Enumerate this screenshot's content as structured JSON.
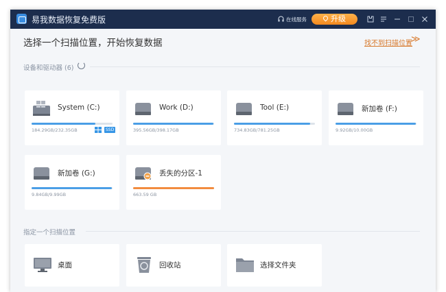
{
  "titlebar": {
    "app_name": "易我数据恢复免费版",
    "service_label": "在线服务",
    "upgrade_label": "升级"
  },
  "header": {
    "title": "选择一个扫描位置，开始恢复数据",
    "cannot_find_link": "找不到扫描位置",
    "cannot_find_arrow": "≫"
  },
  "drives_section": {
    "title": "设备和驱动器 (6)",
    "drives": [
      {
        "name": "System (C:)",
        "size_text": "184.29GB/232.35GB",
        "usage": 0.79,
        "icon": "windows-drive-icon",
        "ssd_label": "SSD"
      },
      {
        "name": "Work (D:)",
        "size_text": "395.56GB/398.17GB",
        "usage": 0.99,
        "icon": "hard-drive-icon"
      },
      {
        "name": "Tool (E:)",
        "size_text": "734.83GB/781.25GB",
        "usage": 0.94,
        "icon": "hard-drive-icon"
      },
      {
        "name": "新加卷 (F:)",
        "size_text": "9.92GB/10.00GB",
        "usage": 0.99,
        "icon": "hard-drive-icon"
      },
      {
        "name": "新加卷 (G:)",
        "size_text": "9.84GB/9.99GB",
        "usage": 0.99,
        "icon": "hard-drive-icon"
      },
      {
        "name": "丢失的分区-1",
        "size_text": "663.59 GB",
        "usage": 1.0,
        "icon": "lost-partition-icon"
      }
    ]
  },
  "locations_section": {
    "title": "指定一个扫描位置",
    "locations": [
      {
        "label": "桌面",
        "icon": "desktop-icon"
      },
      {
        "label": "回收站",
        "icon": "recycle-bin-icon"
      },
      {
        "label": "选择文件夹",
        "icon": "folder-icon"
      }
    ]
  },
  "colors": {
    "titlebar_bg": "#1c2d4d",
    "accent_blue": "#4a9ee6",
    "lost_orange": "#f28c3e",
    "upgrade_orange": "#f5951f",
    "link_orange": "#d7782a"
  }
}
